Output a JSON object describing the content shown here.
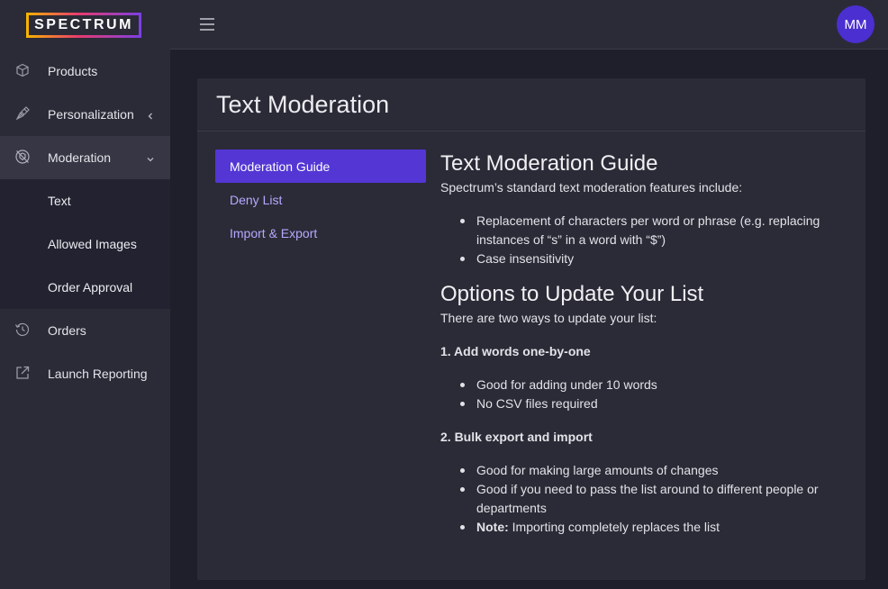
{
  "brand": {
    "logo_text": "SPECTRUM"
  },
  "sidebar": {
    "items": [
      {
        "label": "Products",
        "icon": "cube-icon"
      },
      {
        "label": "Personalization",
        "icon": "pen-nib-icon"
      },
      {
        "label": "Moderation",
        "icon": "moderation-shield-icon"
      },
      {
        "label": "Orders",
        "icon": "history-icon"
      },
      {
        "label": "Launch Reporting",
        "icon": "external-link-icon"
      }
    ],
    "moderation_sub": [
      {
        "label": "Text"
      },
      {
        "label": "Allowed Images"
      },
      {
        "label": "Order Approval"
      }
    ]
  },
  "topbar": {
    "avatar_initials": "MM"
  },
  "page": {
    "title": "Text Moderation",
    "tabs": [
      {
        "label": "Moderation Guide",
        "active": true
      },
      {
        "label": "Deny List",
        "active": false
      },
      {
        "label": "Import & Export",
        "active": false
      }
    ]
  },
  "guide": {
    "heading": "Text Moderation Guide",
    "intro": "Spectrum’s standard text moderation features include:",
    "features": [
      "Replacement of characters per word or phrase (e.g. replacing instances of “s” in a word with “$”)",
      "Case insensitivity"
    ],
    "options_heading": "Options to Update Your List",
    "options_intro": "There are two ways to update your list:",
    "option1_title": "1. Add words one-by-one",
    "option1_points": [
      "Good for adding under 10 words",
      "No CSV files required"
    ],
    "option2_title": "2. Bulk export and import",
    "option2_points": [
      "Good for making large amounts of changes",
      "Good if you need to pass the list around to different people or departments"
    ],
    "option2_note_label": "Note:",
    "option2_note_text": " Importing completely replaces the list"
  },
  "colors": {
    "accent": "#5336d4",
    "avatar": "#4b2fd1",
    "tab_link": "#b6a8ff",
    "sidebar_bg": "#2b2b37",
    "page_bg": "#1f1f2b"
  }
}
